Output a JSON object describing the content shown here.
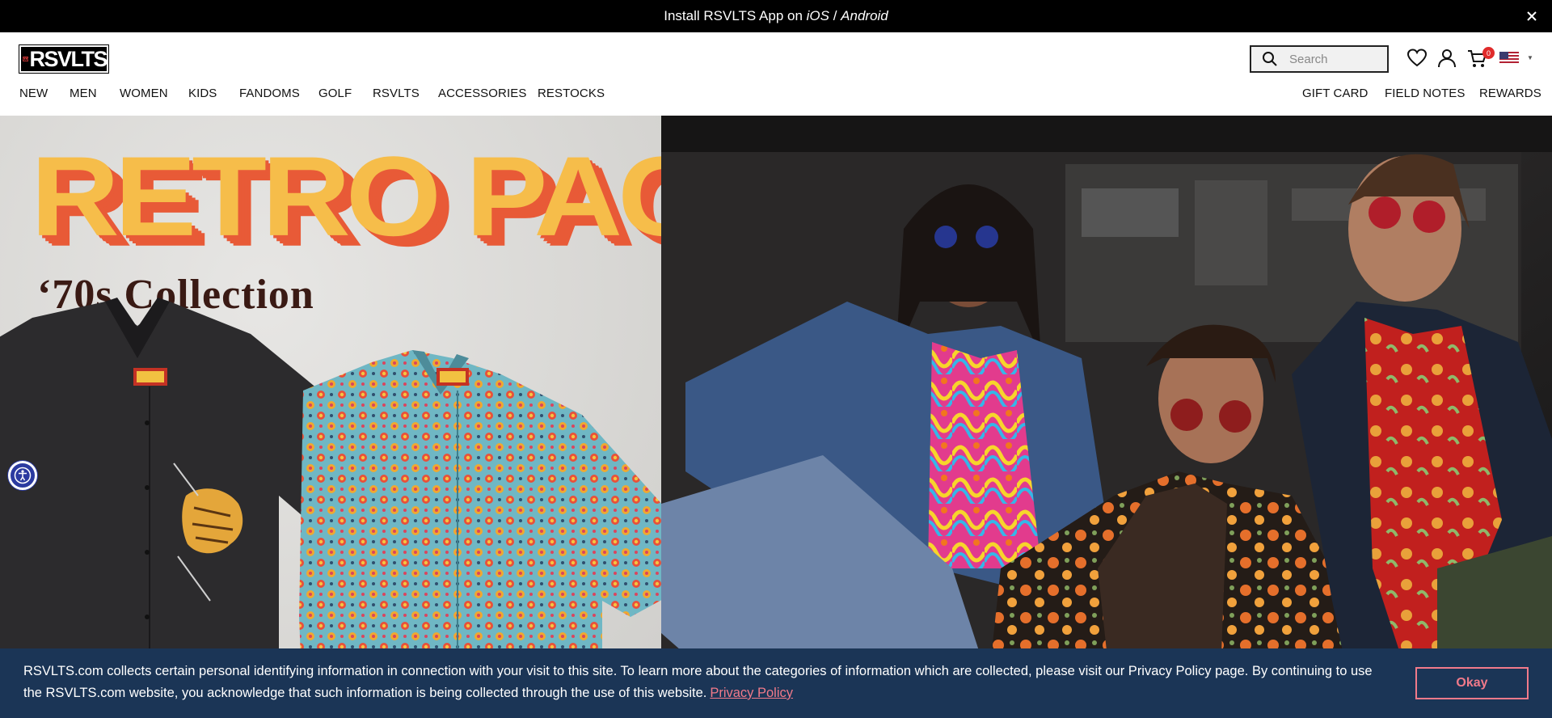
{
  "announcement": {
    "text_prefix": "Install RSVLTS App on ",
    "ios": "iOS",
    "separator": " / ",
    "android": "Android"
  },
  "header": {
    "logo_text": "RSVLTS",
    "search_placeholder": "Search",
    "cart_count": "0"
  },
  "nav": {
    "left": [
      "NEW",
      "MEN",
      "WOMEN",
      "KIDS",
      "FANDOMS",
      "GOLF",
      "RSVLTS",
      "ACCESSORIES",
      "RESTOCKS"
    ],
    "right": [
      "GIFT CARD",
      "FIELD NOTES",
      "REWARDS"
    ]
  },
  "hero": {
    "title": "RETRO PACK",
    "subtitle": "‘70s Collection",
    "shirt_tag": "RSVLTS"
  },
  "cookie": {
    "text": "RSVLTS.com collects certain personal identifying information in connection with your visit to this site. To learn more about the categories of information which are collected, please visit our Privacy Policy page. By continuing to use the RSVLTS.com website, you acknowledge that such information is being collected through the use of this website.",
    "link": "Privacy Policy",
    "button": "Okay"
  },
  "colors": {
    "banner_bg": "#1b3556",
    "accent_pink": "#f17a8a",
    "title_yellow": "#f6bd4a",
    "title_orange": "#e85a37"
  }
}
